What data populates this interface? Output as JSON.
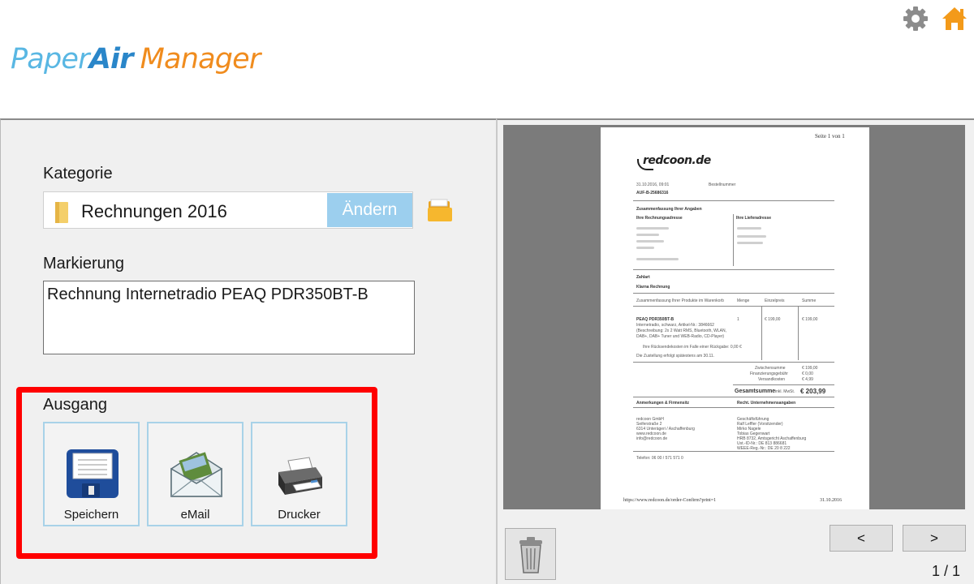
{
  "app": {
    "logo_part1": "Paper",
    "logo_part2": "Air",
    "logo_part3": "Manager",
    "colors": {
      "accent": "#59b7e3",
      "accent_dark": "#2a86c9",
      "orange": "#f08c1e",
      "highlight": "#ff0000",
      "button_blue": "#9ccfee"
    }
  },
  "header": {
    "settings_icon": "gear-icon",
    "home_icon": "home-icon"
  },
  "kategorie": {
    "label": "Kategorie",
    "value": "Rechnungen 2016",
    "change_label": "Ändern",
    "folder_icon": "folder-icon",
    "browse_icon": "open-folder-icon"
  },
  "markierung": {
    "label": "Markierung",
    "value": "Rechnung Internetradio PEAQ PDR350BT-B"
  },
  "ausgang": {
    "label": "Ausgang",
    "buttons": [
      {
        "label": "Speichern",
        "icon": "floppy-disk-icon"
      },
      {
        "label": "eMail",
        "icon": "envelope-icon"
      },
      {
        "label": "Drucker",
        "icon": "printer-icon"
      }
    ]
  },
  "preview": {
    "page_header": "Seite 1 von 1",
    "logo": "redcoon.de",
    "footer_url": "https://www.redcoon.de/order-Confirm?print=1",
    "footer_date": "31.10.2016",
    "doc": {
      "order_date": "31.10.2016, 09:01",
      "order_label": "Bestellnummer",
      "order_number": "AUF-B-25686316",
      "summary_heading": "Zusammenfassung Ihrer Angaben",
      "billing_heading": "Ihre Rechnungsadresse",
      "delivery_heading": "Ihre Lieferadresse",
      "payment_heading": "Zahlart",
      "payment_value": "Klarna Rechnung",
      "products_heading": "Zusammenfassung Ihrer Produkte im Warenkorb",
      "col_qty": "Menge",
      "col_price": "Einzelpreis",
      "col_total": "Summe",
      "product_name": "PEAQ PDR350BT-B",
      "product_line1": "Internetradio, schwarz, Artikel-Nr.: 3846662",
      "product_line2": "(Beschreibung: 2x 2 Watt RMS, Bluetooth, WLAN,",
      "product_line3": "DAB+, DAB+ Tuner und WEB-Radio, CD-Player)",
      "qty": "1",
      "unit_price": "€ 199,00",
      "line_total": "€ 199,00",
      "note1": "Ihre Rücksendekosten im Falle einer Rückgabe: 0,00 €",
      "note2": "Die Zustellung erfolgt spätestens am 30.11.",
      "subtotal_label": "Zwischensumme",
      "subtotal": "€ 199,00",
      "fee_label": "Finanzierungsgebühr",
      "fee": "€ 0,00",
      "shipping_label": "Versandkosten",
      "shipping": "€ 4,99",
      "grand_total_label": "Gesamtsumme",
      "vat_note": "inkl. MwSt.",
      "grand_total": "€ 203,99",
      "company_heading": "Anmerkungen & Firmensitz",
      "legal_heading": "Recht. Unternehmensangaben",
      "company_lines": [
        "redcoon GmbH",
        "Seiferstraße 2",
        "6314 Unterägeri / Aschaffenburg",
        "www.redcoon.de",
        "info@redcoon.de"
      ],
      "legal_lines": [
        "Geschäftsführung",
        "Ralf Leffler (Vorsitzender)",
        "Mirko Nagele",
        "Tobias Gegenwart",
        "HRB 8732, Amtsgericht Aschaffenburg",
        "Ust.-ID-Nr.: DE 813 886681",
        "WEEE-Reg.-Nr.: DE 20 8 222"
      ],
      "phone_line": "Telefon: 06 00 / 571 571 0"
    }
  },
  "footer": {
    "trash_icon": "trash-can-icon",
    "prev_label": "<",
    "next_label": ">",
    "pager": "1 / 1"
  }
}
